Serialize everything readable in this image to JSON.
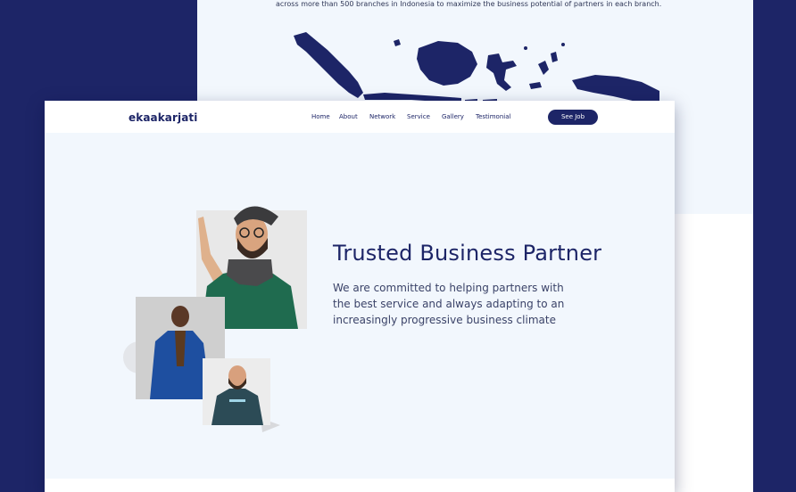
{
  "back_page": {
    "caption": "across more than 500 branches in Indonesia to maximize the business potential of partners in each branch.",
    "map_icon": "indonesia-map"
  },
  "nav": {
    "logo": "ekaakarjati",
    "links": [
      "Home",
      "About",
      "Network",
      "Service",
      "Gallery",
      "Testimonial"
    ],
    "cta": "See Job"
  },
  "hero": {
    "title": "Trusted Business Partner",
    "description": "We are committed to helping partners with the best service and always adapting to an increasingly progressive business climate"
  },
  "photos": [
    "man-with-hat-pointing-photo",
    "man-in-blue-suit-photo",
    "man-in-tshirt-photo"
  ],
  "colors": {
    "navy": "#1d2567",
    "hero_bg": "#f2f7fd",
    "photo_bg": "#e6e6e6",
    "green": "#1f6b4f"
  }
}
